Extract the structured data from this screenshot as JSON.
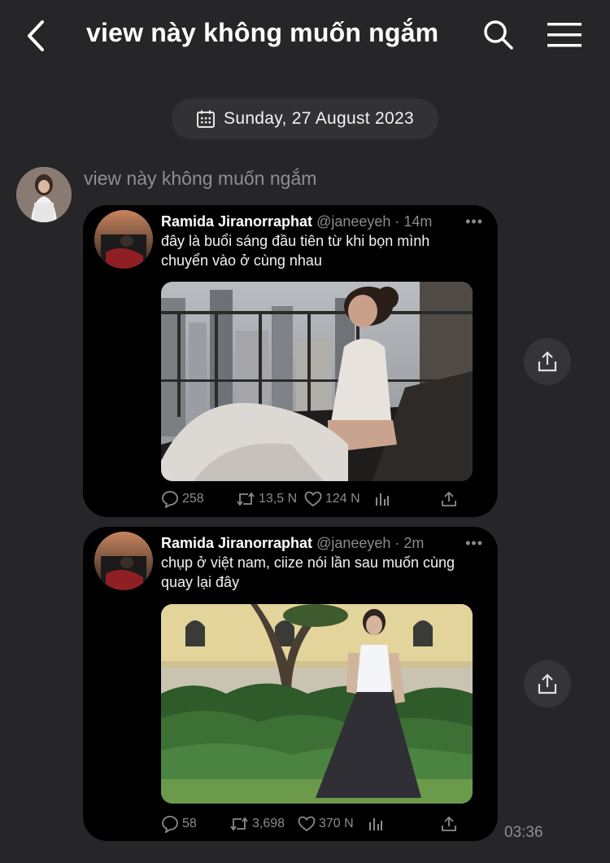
{
  "header": {
    "title": "view này không muốn ngắm",
    "back_icon": "chevron-left-icon",
    "search_icon": "search-icon",
    "menu_icon": "hamburger-menu-icon"
  },
  "date_separator": {
    "icon": "calendar-icon",
    "text": "Sunday, 27 August 2023"
  },
  "message": {
    "sender_name": "view này không muốn ngắm",
    "time": "03:36",
    "tweets": [
      {
        "author_name": "Ramida Jiranorraphat",
        "handle": "@janeeyeh",
        "age": "· 14m",
        "more": "•••",
        "text": "đây là buổi sáng đầu tiên từ khi bọn mình chuyển vào ở cùng nhau",
        "replies": "258",
        "retweets": "13,5 N",
        "likes": "124 N"
      },
      {
        "author_name": "Ramida Jiranorraphat",
        "handle": "@janeeyeh",
        "age": "· 2m",
        "more": "•••",
        "text": "chụp ở việt nam, ciize nói lần sau muốn cùng quay lại đây",
        "replies": "58",
        "retweets": "3,698",
        "likes": "370 N"
      }
    ]
  },
  "colors": {
    "background": "#262628",
    "card": "#000000",
    "muted_text": "#8e8e93",
    "pill": "#323235"
  }
}
